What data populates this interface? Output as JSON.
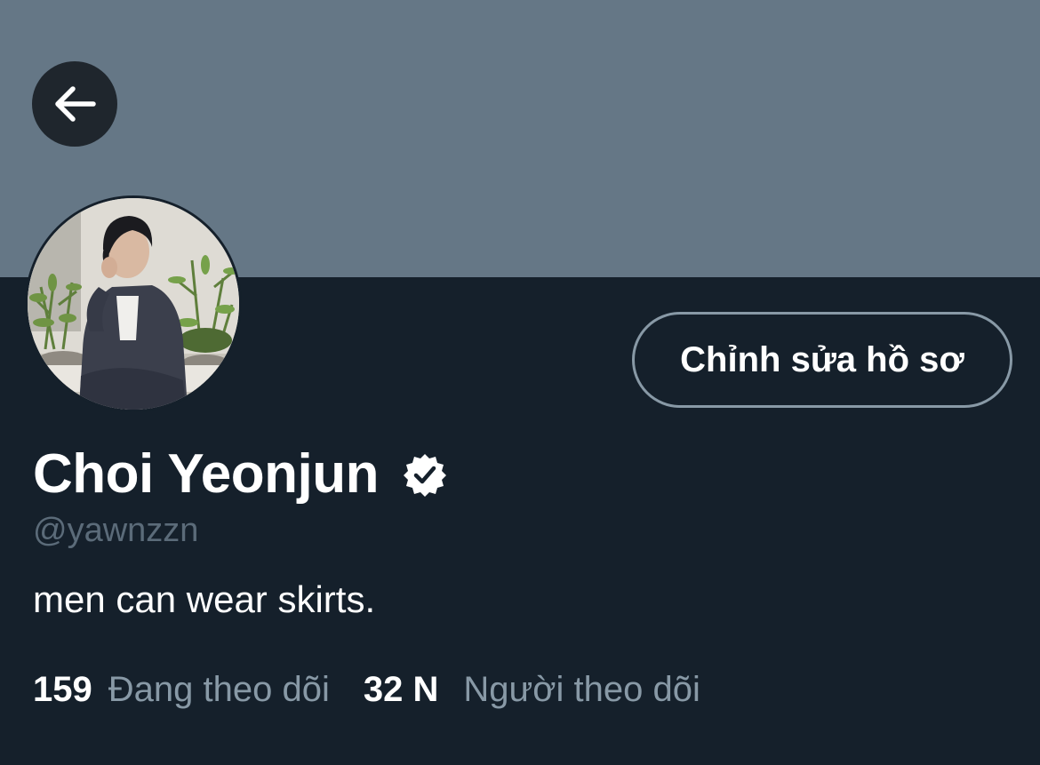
{
  "header": {
    "back_icon": "arrow-left-icon",
    "banner_color": "#657786"
  },
  "profile": {
    "avatar_icon": "profile-photo",
    "edit_button_label": "Chỉnh sửa hồ sơ",
    "display_name": "Choi Yeonjun",
    "verified_icon": "verified-badge-icon",
    "handle": "@yawnzzn",
    "bio": "men can wear skirts."
  },
  "stats": {
    "following_count": "159",
    "following_label": "Đang theo dõi",
    "followers_count": "32 N",
    "followers_label": "Người theo dõi"
  },
  "colors": {
    "background": "#15202b",
    "secondary_text": "#8899a6",
    "primary_text": "#ffffff"
  }
}
